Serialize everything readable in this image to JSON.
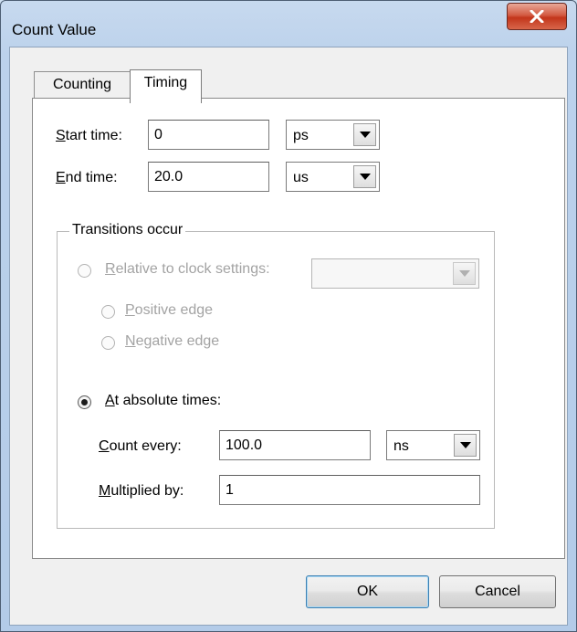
{
  "window": {
    "title": "Count Value",
    "close_icon": "close-x-icon"
  },
  "tabs": [
    {
      "label": "Counting",
      "selected": false
    },
    {
      "label": "Timing",
      "selected": true
    }
  ],
  "timing": {
    "start_time": {
      "label_accel": "S",
      "label_rest": "tart time:",
      "value": "0",
      "unit": "ps"
    },
    "end_time": {
      "label_accel": "E",
      "label_rest": "nd time:",
      "value": "20.0",
      "unit": "us"
    }
  },
  "transitions": {
    "group_title": "Transitions occur",
    "relative": {
      "label_accel": "R",
      "label_rest": "elative to clock settings:",
      "selected": false,
      "enabled": false,
      "clock_value": ""
    },
    "positive_edge": {
      "label_accel": "P",
      "label_rest": "ositive edge",
      "enabled": false,
      "selected": false
    },
    "negative_edge": {
      "label_accel": "N",
      "label_rest": "egative edge",
      "enabled": false,
      "selected": false
    },
    "absolute": {
      "label_accel": "A",
      "label_rest": "t absolute times:",
      "selected": true
    },
    "count_every": {
      "label_accel": "C",
      "label_rest": "ount every:",
      "value": "100.0",
      "unit": "ns"
    },
    "multiplied_by": {
      "label_accel": "M",
      "label_rest": "ultiplied by:",
      "value": "1"
    }
  },
  "buttons": {
    "ok": "OK",
    "cancel": "Cancel"
  },
  "colors": {
    "close_button": "#c7402a",
    "client_background": "#f0f0f0",
    "tab_panel": "#ffffff",
    "disabled_text": "#a3a3a3"
  }
}
